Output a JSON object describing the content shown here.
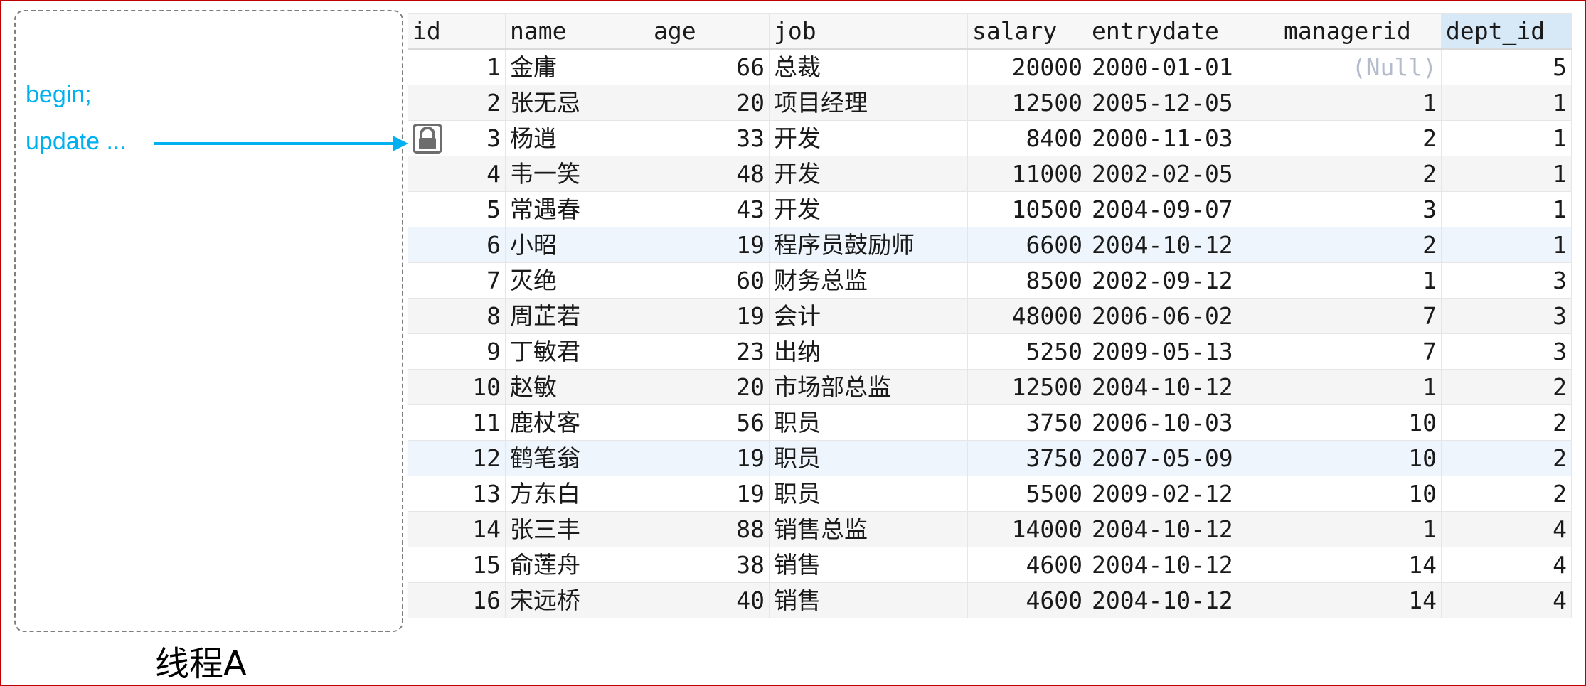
{
  "thread": {
    "code_begin": "begin;",
    "code_update": "update ...",
    "label": "线程A"
  },
  "colors": {
    "frame_border": "#c00000",
    "code_text": "#00b0f0",
    "arrow": "#00b0f0",
    "sorted_header": "#d7e9f7",
    "null_text": "#b4bccb"
  },
  "icons": {
    "row_lock": "lock-icon",
    "pointer": "arrow-right-icon"
  },
  "table": {
    "columns": [
      "id",
      "name",
      "age",
      "job",
      "salary",
      "entrydate",
      "managerid",
      "dept_id"
    ],
    "sorted_column": "dept_id",
    "locked_row_id": "3",
    "highlighted_rows": [
      "6",
      "12"
    ],
    "rows": [
      {
        "id": "1",
        "name": "金庸",
        "age": "66",
        "job": "总裁",
        "salary": "20000",
        "entrydate": "2000-01-01",
        "managerid": "(Null)",
        "dept_id": "5"
      },
      {
        "id": "2",
        "name": "张无忌",
        "age": "20",
        "job": "项目经理",
        "salary": "12500",
        "entrydate": "2005-12-05",
        "managerid": "1",
        "dept_id": "1"
      },
      {
        "id": "3",
        "name": "杨逍",
        "age": "33",
        "job": "开发",
        "salary": "8400",
        "entrydate": "2000-11-03",
        "managerid": "2",
        "dept_id": "1"
      },
      {
        "id": "4",
        "name": "韦一笑",
        "age": "48",
        "job": "开发",
        "salary": "11000",
        "entrydate": "2002-02-05",
        "managerid": "2",
        "dept_id": "1"
      },
      {
        "id": "5",
        "name": "常遇春",
        "age": "43",
        "job": "开发",
        "salary": "10500",
        "entrydate": "2004-09-07",
        "managerid": "3",
        "dept_id": "1"
      },
      {
        "id": "6",
        "name": "小昭",
        "age": "19",
        "job": "程序员鼓励师",
        "salary": "6600",
        "entrydate": "2004-10-12",
        "managerid": "2",
        "dept_id": "1"
      },
      {
        "id": "7",
        "name": "灭绝",
        "age": "60",
        "job": "财务总监",
        "salary": "8500",
        "entrydate": "2002-09-12",
        "managerid": "1",
        "dept_id": "3"
      },
      {
        "id": "8",
        "name": "周芷若",
        "age": "19",
        "job": "会计",
        "salary": "48000",
        "entrydate": "2006-06-02",
        "managerid": "7",
        "dept_id": "3"
      },
      {
        "id": "9",
        "name": "丁敏君",
        "age": "23",
        "job": "出纳",
        "salary": "5250",
        "entrydate": "2009-05-13",
        "managerid": "7",
        "dept_id": "3"
      },
      {
        "id": "10",
        "name": "赵敏",
        "age": "20",
        "job": "市场部总监",
        "salary": "12500",
        "entrydate": "2004-10-12",
        "managerid": "1",
        "dept_id": "2"
      },
      {
        "id": "11",
        "name": "鹿杖客",
        "age": "56",
        "job": "职员",
        "salary": "3750",
        "entrydate": "2006-10-03",
        "managerid": "10",
        "dept_id": "2"
      },
      {
        "id": "12",
        "name": "鹤笔翁",
        "age": "19",
        "job": "职员",
        "salary": "3750",
        "entrydate": "2007-05-09",
        "managerid": "10",
        "dept_id": "2"
      },
      {
        "id": "13",
        "name": "方东白",
        "age": "19",
        "job": "职员",
        "salary": "5500",
        "entrydate": "2009-02-12",
        "managerid": "10",
        "dept_id": "2"
      },
      {
        "id": "14",
        "name": "张三丰",
        "age": "88",
        "job": "销售总监",
        "salary": "14000",
        "entrydate": "2004-10-12",
        "managerid": "1",
        "dept_id": "4"
      },
      {
        "id": "15",
        "name": "俞莲舟",
        "age": "38",
        "job": "销售",
        "salary": "4600",
        "entrydate": "2004-10-12",
        "managerid": "14",
        "dept_id": "4"
      },
      {
        "id": "16",
        "name": "宋远桥",
        "age": "40",
        "job": "销售",
        "salary": "4600",
        "entrydate": "2004-10-12",
        "managerid": "14",
        "dept_id": "4"
      }
    ]
  }
}
